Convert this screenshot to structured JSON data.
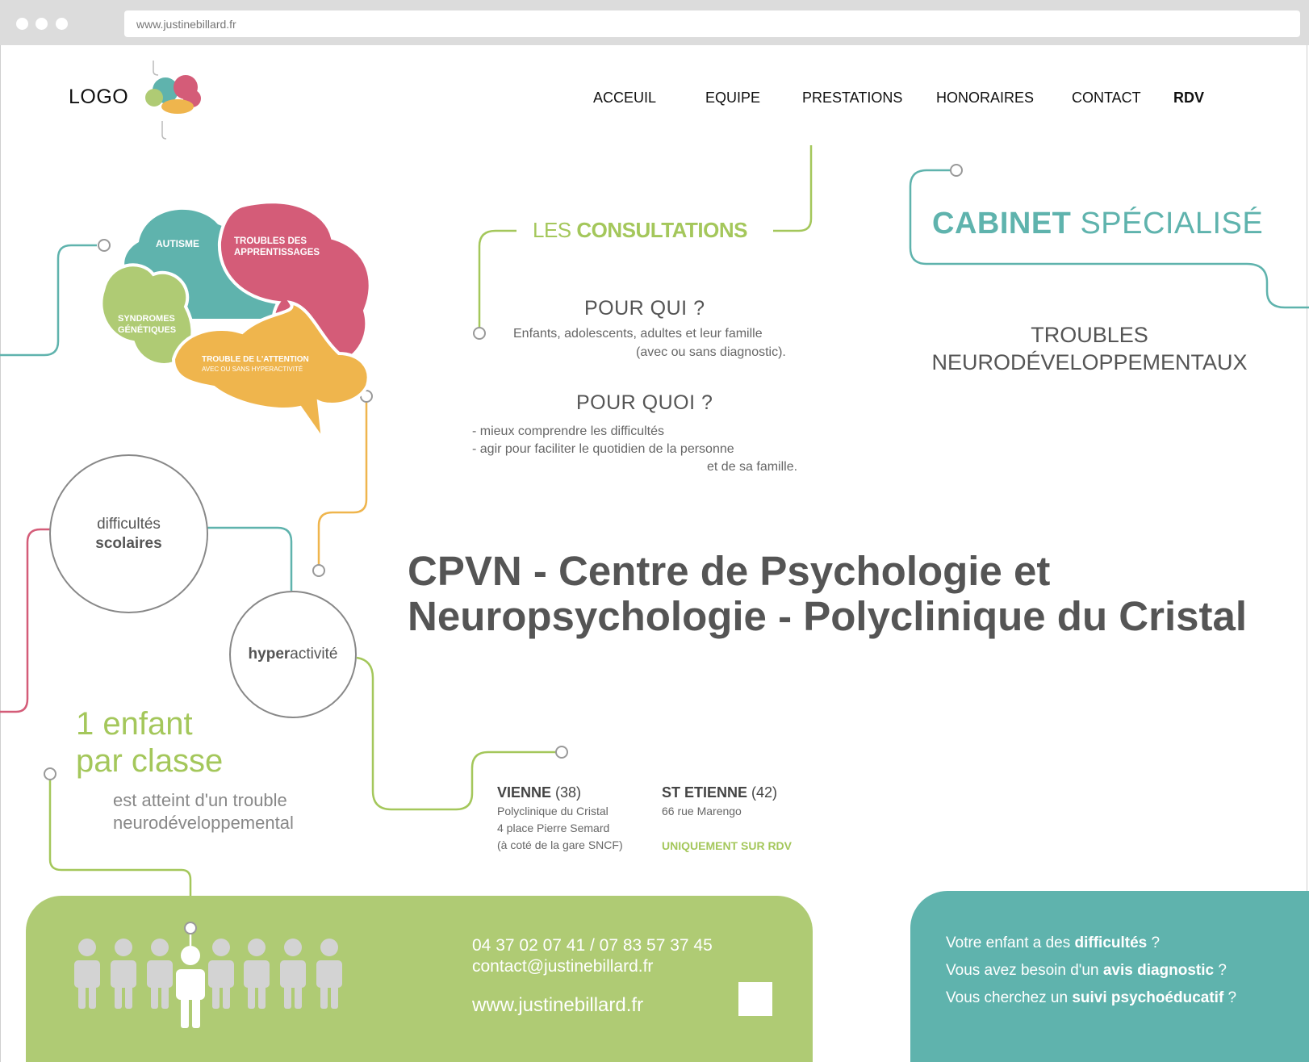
{
  "browser": {
    "url": "www.justinebillard.fr"
  },
  "header": {
    "logo_text": "LOGO",
    "nav": [
      "ACCEUIL",
      "EQUIPE",
      "PRESTATIONS",
      "HONORAIRES",
      "CONTACT",
      "RDV"
    ]
  },
  "brain": {
    "autisme": "AUTISME",
    "troubles_1": "TROUBLES DES",
    "troubles_2": "APPRENTISSAGES",
    "syndromes_1": "SYNDROMES",
    "syndromes_2": "GÉNÉTIQUES",
    "attention_1": "TROUBLE DE L'ATTENTION",
    "attention_2": "AVEC OU SANS HYPERACTIVITÉ"
  },
  "consultations": {
    "title_light": "LES ",
    "title_bold": "CONSULTATIONS",
    "pour_qui": "POUR QUI ?",
    "pour_qui_l1": "Enfants, adolescents, adultes et leur famille",
    "pour_qui_l2": "(avec ou sans diagnostic).",
    "pour_quoi": "POUR QUOI ?",
    "pour_quoi_l1": "- mieux comprendre les difficultés",
    "pour_quoi_l2": "- agir pour faciliter le quotidien de la personne",
    "pour_quoi_l3": "et de sa famille."
  },
  "cabinet": {
    "bold": "CABINET",
    "light": " SPÉCIALISÉ",
    "troubles_l1": "TROUBLES",
    "troubles_l2": "NEURODÉVELOPPEMENTAUX"
  },
  "circles": {
    "difficultes_l1": "difficultés",
    "difficultes_l2": "scolaires",
    "hyper_bold": "hyper",
    "hyper_light": "activité"
  },
  "headline": "CPVN - Centre de Psychologie et Neuropsychologie - Polyclinique du Cristal",
  "stat": {
    "l1": "1 enfant",
    "l2": "par classe",
    "l3": "est atteint d'un trouble",
    "l4": "neurodéveloppemental"
  },
  "addresses": {
    "vienne_city": "VIENNE",
    "vienne_code": " (38)",
    "vienne_l1": "Polyclinique du Cristal",
    "vienne_l2": "4 place Pierre Semard",
    "vienne_l3": "(à coté de la gare SNCF)",
    "st_city": "ST ETIENNE",
    "st_code": " (42)",
    "st_l1": "66 rue Marengo",
    "rdv_only": "UNIQUEMENT SUR RDV"
  },
  "contact": {
    "phones": "04 37 02 07 41  /  07 83 57 37 45",
    "email": "contact@justinebillard.fr",
    "website": "www.justinebillard.fr"
  },
  "questions": {
    "q1_a": "Votre enfant a des ",
    "q1_b": "difficultés",
    "q1_c": " ?",
    "q2_a": "Vous avez besoin d'un ",
    "q2_b": "avis diagnostic",
    "q2_c": " ?",
    "q3_a": "Vous cherchez un ",
    "q3_b": "suivi psychoéducatif",
    "q3_c": " ?"
  },
  "colors": {
    "green": "#afcb74",
    "teal": "#5fb3ad",
    "pink": "#d45c78",
    "orange": "#efb54d",
    "lime": "#a4c75b"
  }
}
